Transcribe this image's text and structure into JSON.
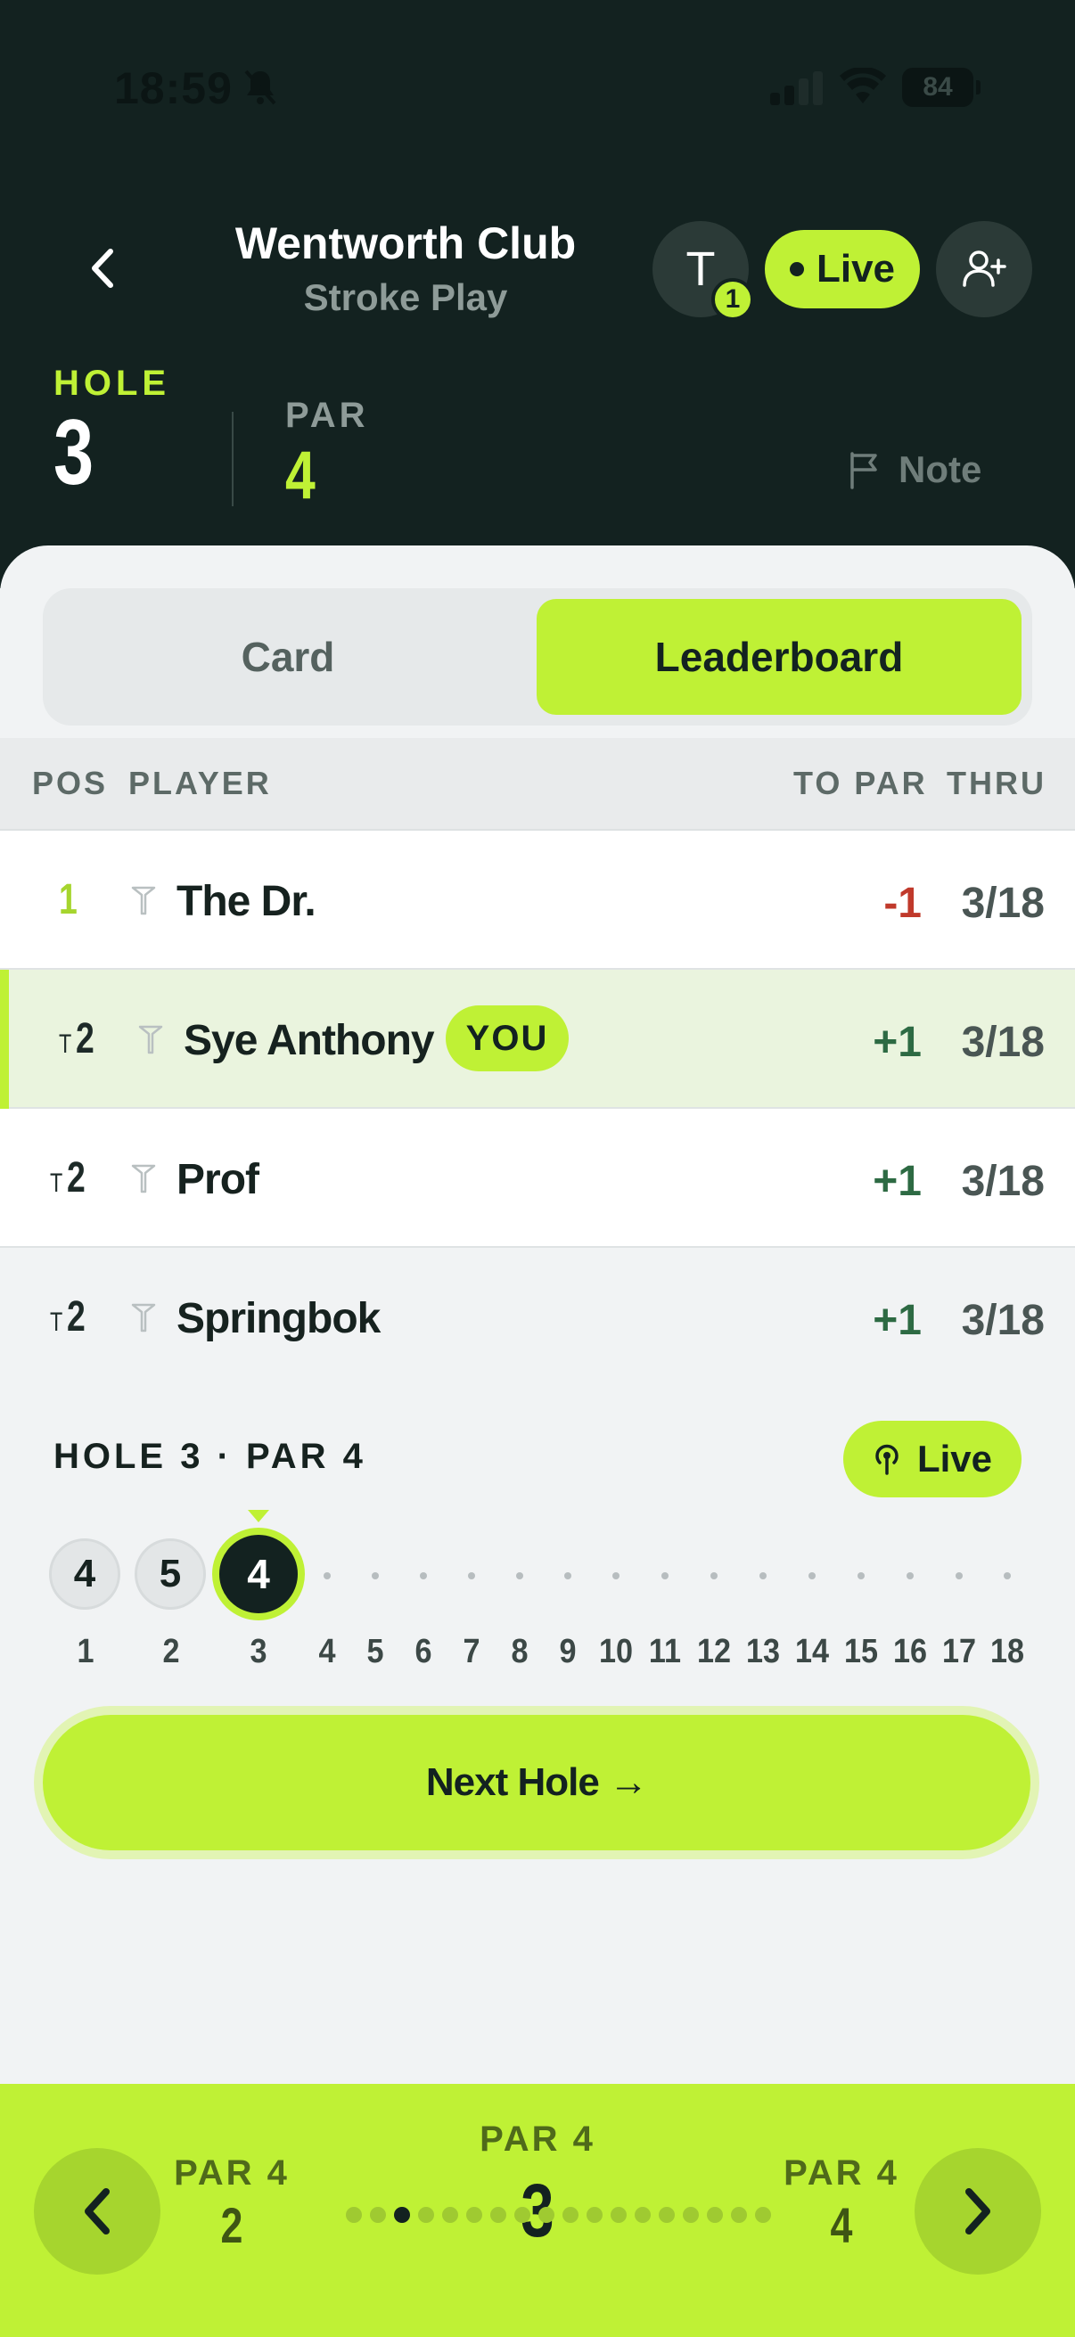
{
  "status_bar": {
    "time": "18:59",
    "battery": "84"
  },
  "header": {
    "course_name": "Wentworth Club",
    "mode": "Stroke Play",
    "tee_badge_letter": "T",
    "tee_badge_count": "1",
    "live_label": "Live"
  },
  "hole_info": {
    "hole_label": "HOLE",
    "hole_number": "3",
    "par_label": "PAR",
    "par_value": "4",
    "note_label": "Note"
  },
  "tabs": {
    "card": "Card",
    "leaderboard": "Leaderboard",
    "active": "Leaderboard"
  },
  "table": {
    "headers": {
      "pos": "POS",
      "player": "PLAYER",
      "to_par": "TO PAR",
      "thru": "THRU"
    },
    "rows": [
      {
        "pos_prefix": "",
        "pos": "1",
        "name": "The Dr.",
        "to_par": "-1",
        "thru": "3/18",
        "you": false
      },
      {
        "pos_prefix": "T",
        "pos": "2",
        "name": "Sye Anthony",
        "to_par": "+1",
        "thru": "3/18",
        "you": true,
        "you_label": "YOU"
      },
      {
        "pos_prefix": "T",
        "pos": "2",
        "name": "Prof",
        "to_par": "+1",
        "thru": "3/18",
        "you": false
      },
      {
        "pos_prefix": "T",
        "pos": "2",
        "name": "Springbok",
        "to_par": "+1",
        "thru": "3/18",
        "you": false
      }
    ]
  },
  "scorecard": {
    "title": "HOLE 3 · PAR 4",
    "live_label": "Live",
    "scores": [
      "4",
      "5",
      "4"
    ],
    "holes": [
      "1",
      "2",
      "3",
      "4",
      "5",
      "6",
      "7",
      "8",
      "9",
      "10",
      "11",
      "12",
      "13",
      "14",
      "15",
      "16",
      "17",
      "18"
    ],
    "current_hole": 3
  },
  "next_hole_label": "Next Hole →",
  "bottom_nav": {
    "prev": {
      "par": "PAR 4",
      "hole": "2"
    },
    "current": {
      "par": "PAR 4",
      "hole": "3"
    },
    "next": {
      "par": "PAR 4",
      "hole": "4"
    },
    "pages": 18,
    "active_page": 3
  },
  "colors": {
    "accent": "#bff135",
    "dark": "#132220",
    "under_par": "#c0392b",
    "over_par": "#2d6a43",
    "background": "#f1f3f4"
  },
  "icons": [
    "back-chevron-icon",
    "tee-icon",
    "add-player-icon",
    "flag-icon",
    "broadcast-icon",
    "chevron-left-icon",
    "chevron-right-icon"
  ]
}
